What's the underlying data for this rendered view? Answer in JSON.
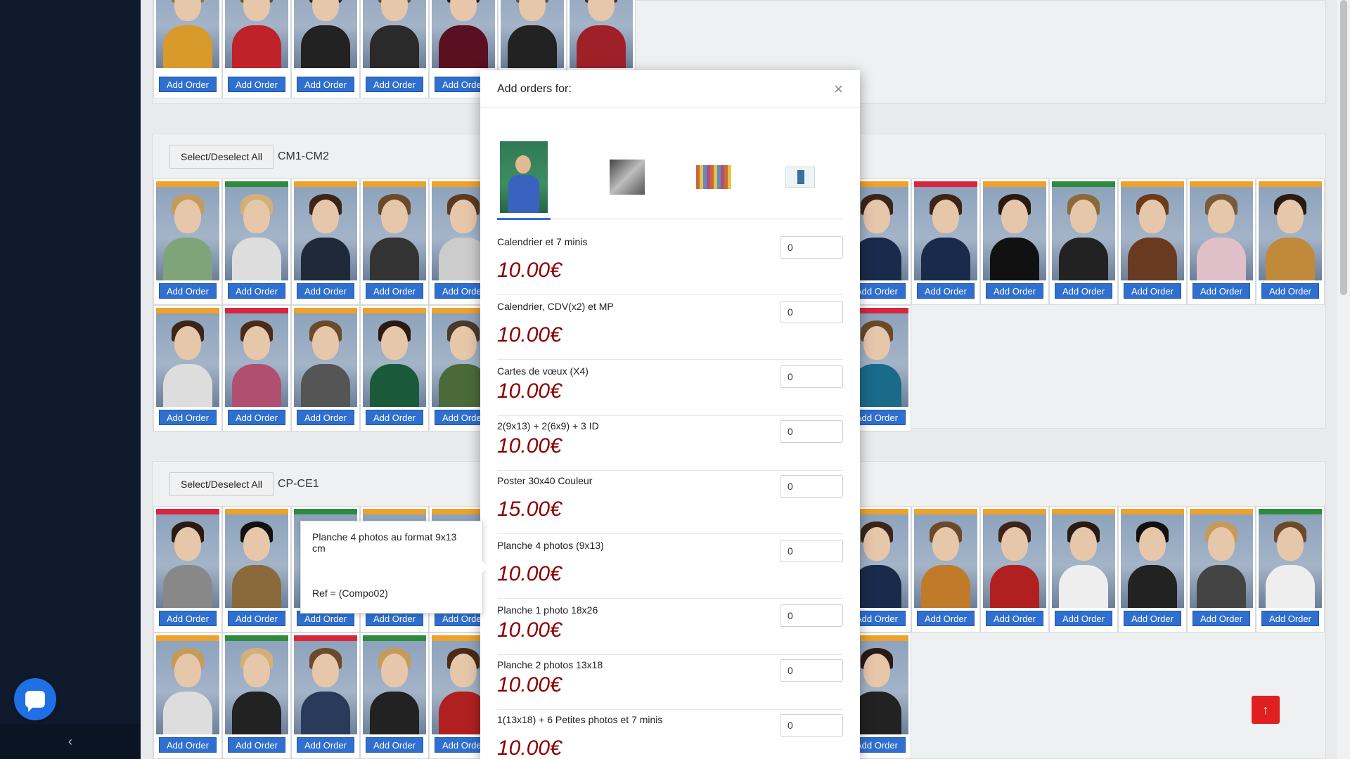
{
  "colors": {
    "orange": "#f0a12a",
    "green": "#2e8b3e",
    "red": "#d7263d",
    "accent": "#2f6fd0",
    "price": "#8b0000"
  },
  "sidebar": {
    "toggle_icon": "chevron-left-icon",
    "toggle_glyph": "‹"
  },
  "classes": [
    {
      "name": "CM1-CM2",
      "select_label": "Select/Deselect All"
    },
    {
      "name": "CP-CE1",
      "select_label": "Select/Deselect All"
    }
  ],
  "add_order_label": "Add Order",
  "modal": {
    "title": "Add orders for:",
    "close_glyph": "×",
    "products": [
      {
        "name": "Calendrier et 7 minis",
        "price": "10.00€",
        "qty": "0"
      },
      {
        "name": "Calendrier, CDV(x2) et MP",
        "price": "10.00€",
        "qty": "0"
      },
      {
        "name": "Cartes de vœux (X4)",
        "price": "10.00€",
        "qty": "0"
      },
      {
        "name": "2(9x13) + 2(6x9) + 3 ID",
        "price": "10.00€",
        "qty": "0"
      },
      {
        "name": "Poster 30x40 Couleur",
        "price": "15.00€",
        "qty": "0"
      },
      {
        "name": "Planche 4 photos (9x13)",
        "price": "10.00€",
        "qty": "0"
      },
      {
        "name": "Planche 1 photo 18x26",
        "price": "10.00€",
        "qty": "0"
      },
      {
        "name": "Planche 2 photos 13x18",
        "price": "10.00€",
        "qty": "0"
      },
      {
        "name": "1(13x18) + 6 Petites photos et 7 minis",
        "price": "10.00€",
        "qty": "0"
      }
    ]
  },
  "tooltip": {
    "line1": "Planche 4 photos au format 9x13 cm",
    "line2": "Ref = (Compo02)"
  },
  "to_top_glyph": "↑"
}
